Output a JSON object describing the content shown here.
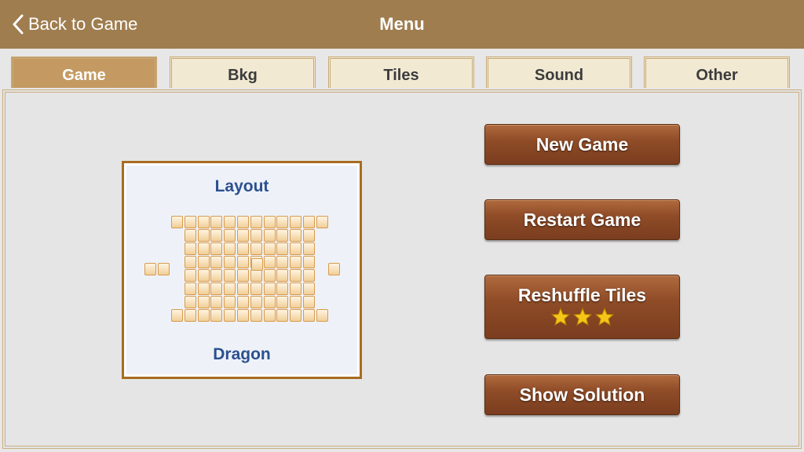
{
  "header": {
    "back_label": "Back to Game",
    "title": "Menu"
  },
  "tabs": [
    {
      "label": "Game",
      "active": true
    },
    {
      "label": "Bkg",
      "active": false
    },
    {
      "label": "Tiles",
      "active": false
    },
    {
      "label": "Sound",
      "active": false
    },
    {
      "label": "Other",
      "active": false
    }
  ],
  "layout_card": {
    "heading": "Layout",
    "name": "Dragon"
  },
  "buttons": {
    "new_game": "New Game",
    "restart_game": "Restart Game",
    "reshuffle_tiles": "Reshuffle Tiles",
    "reshuffle_stars": 3,
    "show_solution": "Show Solution"
  },
  "colors": {
    "header": "#9f7d4f",
    "active_tab": "#c49a62",
    "wood": "#8f4c27",
    "label_blue": "#2b5090",
    "star": "#f5c518"
  }
}
